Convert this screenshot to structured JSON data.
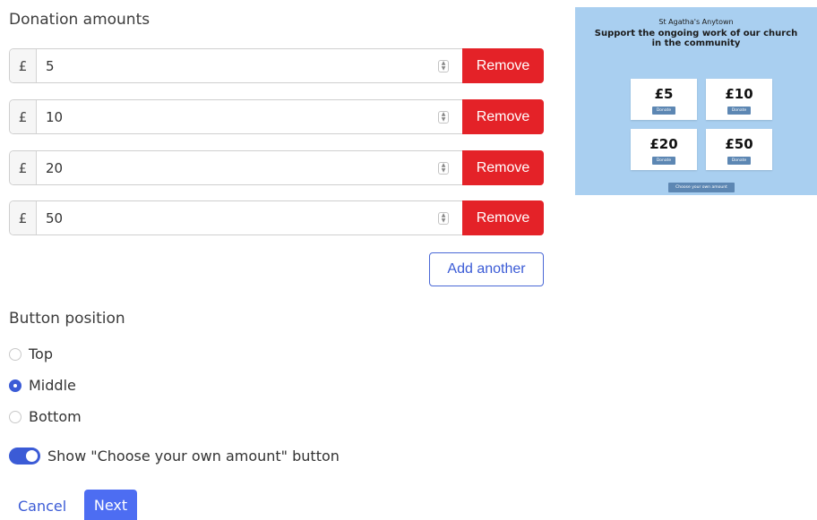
{
  "donation_amounts": {
    "title": "Donation amounts",
    "currency_symbol": "£",
    "amounts": [
      "5",
      "10",
      "20",
      "50"
    ],
    "remove_label": "Remove",
    "add_label": "Add another"
  },
  "button_position": {
    "title": "Button position",
    "options": [
      "Top",
      "Middle",
      "Bottom"
    ],
    "selected": "Middle"
  },
  "toggle": {
    "label": "Show \"Choose your own amount\" button",
    "on": true
  },
  "actions": {
    "cancel_label": "Cancel",
    "next_label": "Next"
  },
  "preview": {
    "org_name": "St Agatha's Anytown",
    "headline": "Support the ongoing work of our church in the community",
    "cards": [
      "£5",
      "£10",
      "£20",
      "£50"
    ],
    "donate_label": "Donate",
    "choose_label": "Choose your own amount",
    "background_color": "#a9cff0"
  },
  "colors": {
    "accent": "#3b5bd6",
    "remove": "#e42228"
  }
}
